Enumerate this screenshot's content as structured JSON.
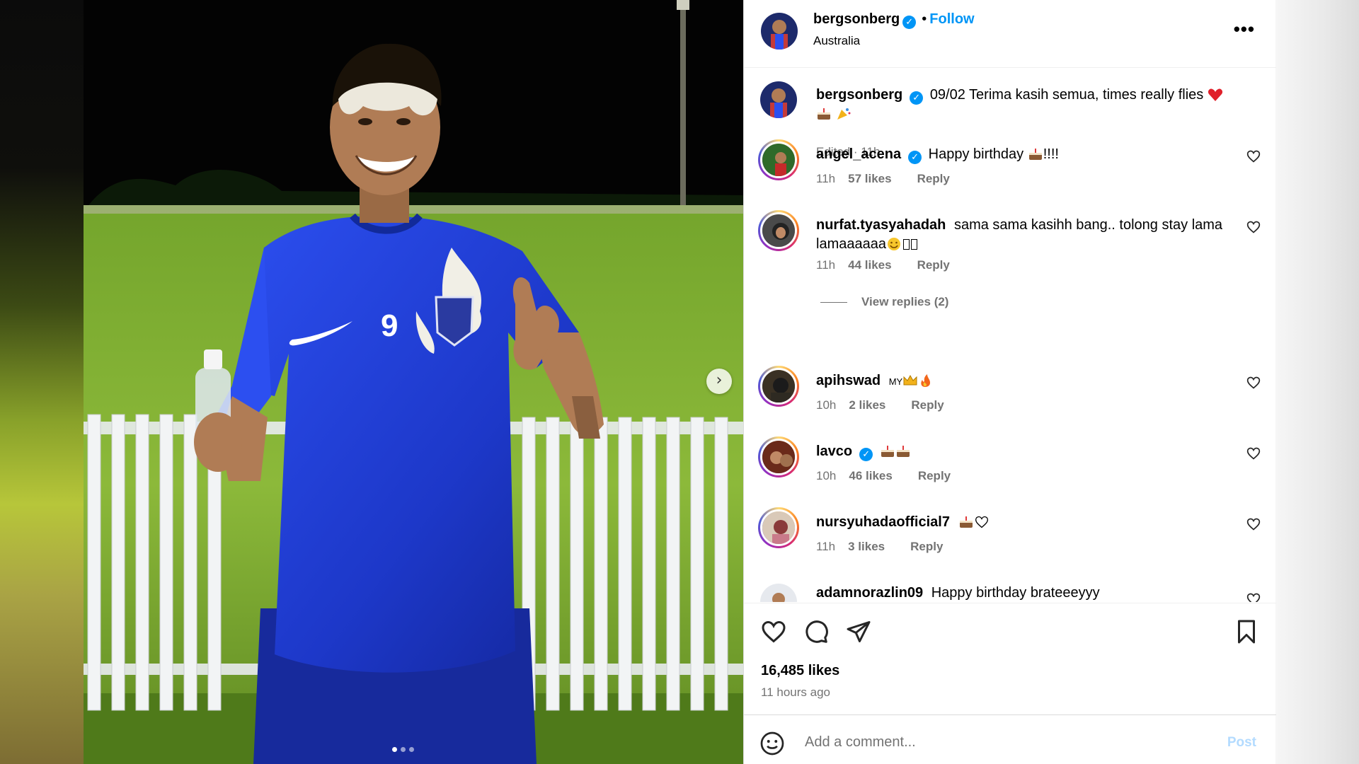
{
  "post": {
    "username": "bergsonberg",
    "follow_label": "Follow",
    "bullet": "•",
    "location": "Australia",
    "more_label": "•••",
    "caption": "09/02 Terima kasih semua, times really flies",
    "caption_edited": "Edited · 11h",
    "likes": "16,485 likes",
    "time_ago": "11 hours ago"
  },
  "comments": [
    {
      "username": "angel_acena",
      "verified": true,
      "text": "Happy birthday",
      "text_suffix": "!!!!",
      "time": "11h",
      "likes": "57 likes",
      "reply": "Reply"
    },
    {
      "username": "nurfat.tyasyahadah",
      "verified": false,
      "text": "sama sama kasihh bang.. tolong stay lama lamaaaaaa",
      "text_suffix": "",
      "time": "11h",
      "likes": "44 likes",
      "reply": "Reply",
      "view_replies": "View replies (2)"
    },
    {
      "username": "apihswad",
      "verified": false,
      "text": "MY",
      "text_suffix": "",
      "time": "10h",
      "likes": "2 likes",
      "reply": "Reply"
    },
    {
      "username": "lavco",
      "verified": true,
      "text": "",
      "text_suffix": "",
      "time": "10h",
      "likes": "46 likes",
      "reply": "Reply"
    },
    {
      "username": "nursyuhadaofficial7",
      "verified": false,
      "text": "",
      "text_suffix": "",
      "time": "11h",
      "likes": "3 likes",
      "reply": "Reply"
    },
    {
      "username": "adamnorazlin09",
      "verified": false,
      "text": "Happy birthday brateeeyyy",
      "text_suffix": "",
      "time": "",
      "likes": "",
      "reply": ""
    }
  ],
  "composer": {
    "placeholder": "Add a comment...",
    "post_label": "Post"
  },
  "icons": {
    "verified": "✓",
    "next": "›",
    "heart": "heart-icon",
    "comment": "comment-icon",
    "share": "share-icon",
    "save": "bookmark-icon",
    "emoji": "smiley-icon"
  },
  "colors": {
    "accent": "#0095f6",
    "jersey": "#1f3fd8",
    "muted": "#737373"
  }
}
